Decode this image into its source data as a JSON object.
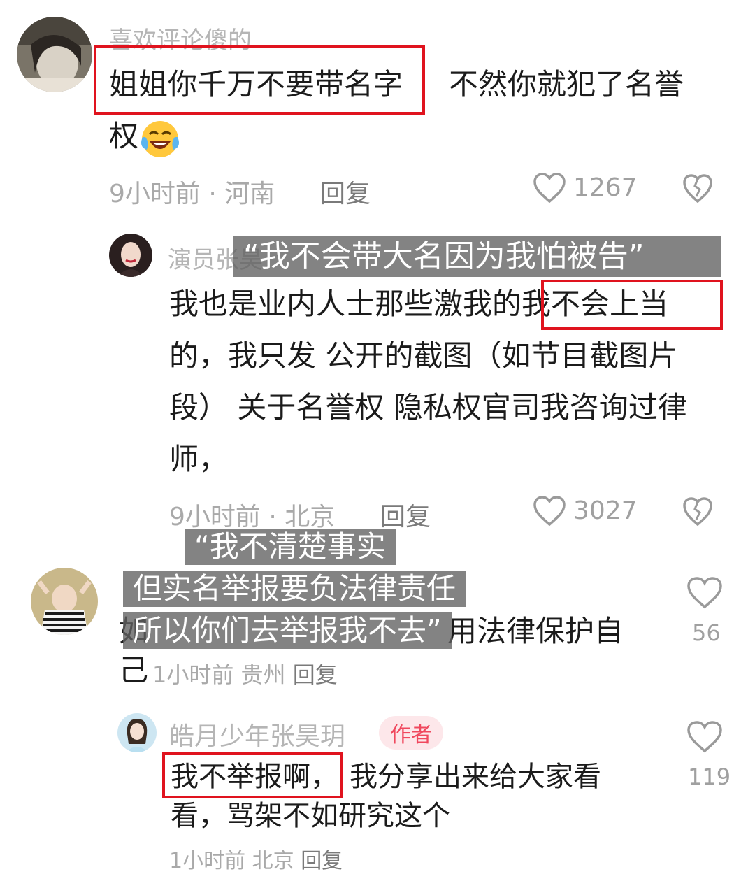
{
  "comments": [
    {
      "username": "喜欢评论傻的",
      "text_line1_highlight": "姐姐你千万不要带名字",
      "text_line1_rest": "不然你就犯了名誉",
      "text_line2": "权",
      "emoji_icon": "laughing-crying-emoji",
      "time": "9小时前",
      "location": "河南",
      "reply_label": "回复",
      "likes": "1267"
    },
    {
      "username": "演员张昊",
      "text_line1_rest": "我也是业内人士那些激我的",
      "text_line1_highlight": "我不会上当",
      "text_line2": "的，我只发 公开的截图（如节目截图片",
      "text_line3": "段） 关于名誉权 隐私权官司我咨询过律",
      "text_line4": "师，",
      "time": "9小时前",
      "location": "北京",
      "reply_label": "回复",
      "likes": "3027"
    },
    {
      "text_line1_start": "如",
      "text_line1_end": "用法律保护自",
      "text_line2_start": "己",
      "time": "1小时前",
      "location": "贵州",
      "reply_label": "回复",
      "likes": "56"
    },
    {
      "username": "皓月少年张昊玥",
      "badge": "作者",
      "text_line1_highlight": "我不举报啊，",
      "text_line1_rest": "我分享出来给大家看",
      "text_line2": "看，骂架不如研究这个",
      "time": "1小时前",
      "location": "北京",
      "reply_label": "回复",
      "likes": "119"
    }
  ],
  "captions": {
    "caption1": "“我不会带大名因为我怕被告”",
    "caption2": "“我不清楚事实",
    "caption3": "但实名举报要负法律责任",
    "caption4": "所以你们去举报我不去”"
  },
  "colors": {
    "highlight_box": "#e0131e",
    "caption_bg": "#606060",
    "author_badge": "#f0485e"
  }
}
